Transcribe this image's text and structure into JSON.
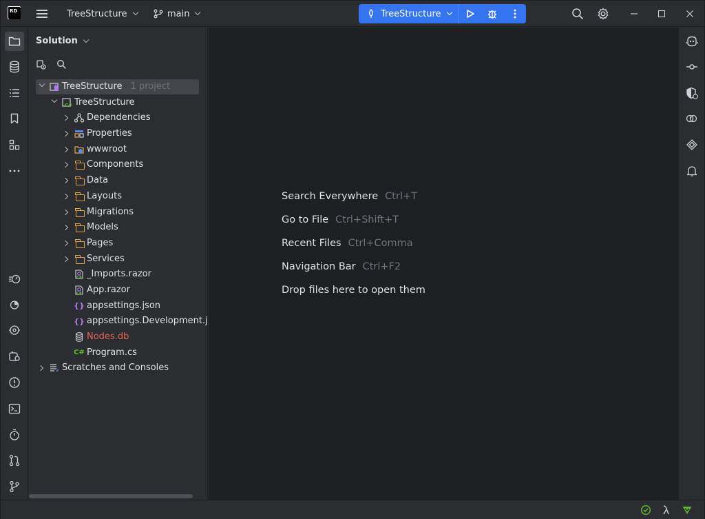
{
  "titlebar": {
    "logo_text": "RD",
    "project_name": "TreeStructure",
    "branch": "main",
    "run_config": "TreeStructure"
  },
  "panel": {
    "title": "Solution"
  },
  "tree": {
    "solution": {
      "label": "TreeStructure",
      "hint": "1 project"
    },
    "project": {
      "label": "TreeStructure"
    },
    "items": [
      {
        "label": "Dependencies"
      },
      {
        "label": "Properties"
      },
      {
        "label": "wwwroot"
      },
      {
        "label": "Components"
      },
      {
        "label": "Data"
      },
      {
        "label": "Layouts"
      },
      {
        "label": "Migrations"
      },
      {
        "label": "Models"
      },
      {
        "label": "Pages"
      },
      {
        "label": "Services"
      },
      {
        "label": "_Imports.razor"
      },
      {
        "label": "App.razor"
      },
      {
        "label": "appsettings.json"
      },
      {
        "label": "appsettings.Development.json"
      },
      {
        "label": "Nodes.db"
      },
      {
        "label": "Program.cs"
      }
    ],
    "scratches": {
      "label": "Scratches and Consoles"
    }
  },
  "editor": {
    "actions": [
      {
        "label": "Search Everywhere",
        "shortcut": "Ctrl+T"
      },
      {
        "label": "Go to File",
        "shortcut": "Ctrl+Shift+T"
      },
      {
        "label": "Recent Files",
        "shortcut": "Ctrl+Comma"
      },
      {
        "label": "Navigation Bar",
        "shortcut": "Ctrl+F2"
      },
      {
        "label": "Drop files here to open them",
        "shortcut": ""
      }
    ]
  },
  "colors": {
    "accent": "#3574f0",
    "folder": "#e3a646",
    "db_file": "#e0645a",
    "csharp": "#5fb832",
    "json": "#b07bf0"
  }
}
